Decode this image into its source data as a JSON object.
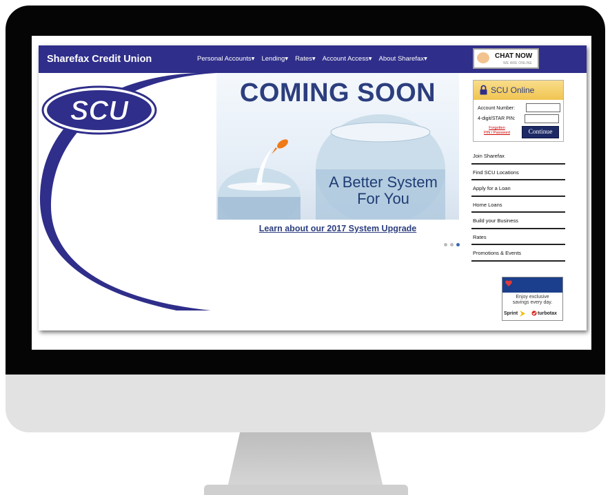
{
  "site": {
    "brand": "Sharefax Credit Union",
    "nav": [
      "Personal Accounts▾",
      "Lending▾",
      "Rates▾",
      "Account Access▾",
      "About Sharefax▾"
    ],
    "chat": {
      "title": "CHAT NOW",
      "subtitle": "WE ARE ONLINE"
    },
    "logo_text": "SCU"
  },
  "hero": {
    "title": "COMING SOON",
    "tagline_line1": "A Better System",
    "tagline_line2": "For You",
    "link": "Learn about our 2017 System Upgrade",
    "slides": 3,
    "active_slide": 3
  },
  "login": {
    "title": "SCU Online",
    "account_label": "Account Number:",
    "pin_label": "4-digit/STAR PIN:",
    "forgot_line1": "Forgotten",
    "forgot_line2": "PIN / Password",
    "continue_label": "Continue"
  },
  "side_links": [
    "Join Sharefax",
    "Find SCU Locations",
    "Apply for a Loan",
    "Home Loans",
    "Build your Business",
    "Rates",
    "Promotions & Events"
  ],
  "promo": {
    "line1": "Enjoy exclusive",
    "line2": "savings every day.",
    "brand1": "Sprint",
    "brand2": "turbotax"
  },
  "colors": {
    "nav_bg": "#2f2e8a",
    "brand_blue": "#2c3e7e",
    "login_header": "#f0c451",
    "button": "#1d2a66",
    "link_red": "#cc0000"
  }
}
